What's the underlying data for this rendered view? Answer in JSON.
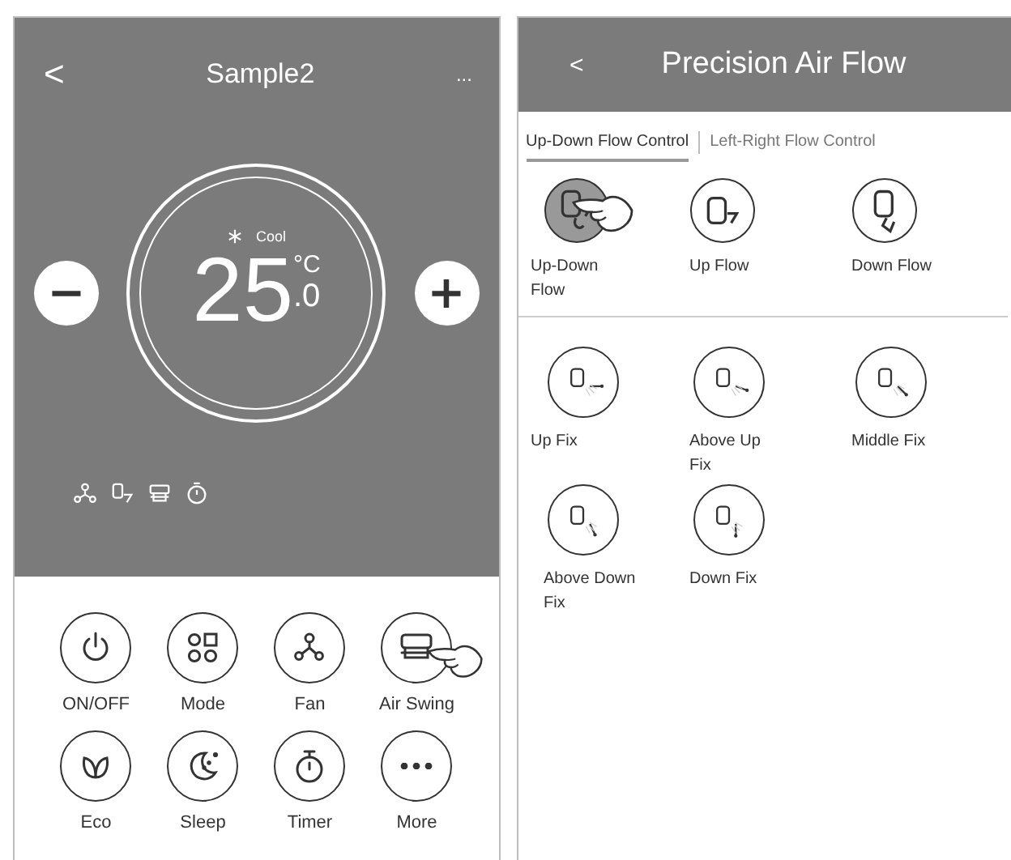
{
  "main_screen": {
    "back": "<",
    "title": "Sample2",
    "menu": "...",
    "mode": "Cool",
    "temperature": "25",
    "unit": "°C",
    "decimal": ".0",
    "minus": "−",
    "plus": "+",
    "buttons": [
      {
        "label": "ON/OFF",
        "kind": "power",
        "pressed": false
      },
      {
        "label": "Mode",
        "kind": "mode",
        "pressed": false
      },
      {
        "label": "Fan",
        "kind": "fan",
        "pressed": false
      },
      {
        "label": "Air Swing",
        "kind": "swing",
        "pressed": true
      },
      {
        "label": "Eco",
        "kind": "eco",
        "pressed": false
      },
      {
        "label": "Sleep",
        "kind": "sleep",
        "pressed": false
      },
      {
        "label": "Timer",
        "kind": "timer",
        "pressed": false
      },
      {
        "label": "More",
        "kind": "more",
        "pressed": false
      }
    ]
  },
  "air_flow_screen": {
    "back": "<",
    "title": "Precision Air Flow",
    "tabs": [
      {
        "label": "Up-Down Flow Control",
        "selected": true
      },
      {
        "label": "Left-Right Flow Control",
        "selected": false
      }
    ],
    "flow_options": [
      {
        "label": "Up-Down Flow",
        "kind": "swing",
        "selected": true
      },
      {
        "label": "Up Flow",
        "kind": "up",
        "selected": false
      },
      {
        "label": "Down Flow",
        "kind": "down",
        "selected": false
      }
    ],
    "fix_options": [
      {
        "label": "Up Fix",
        "kind": "fix0",
        "selected": false
      },
      {
        "label": "Above Up Fix",
        "kind": "fix1",
        "selected": false
      },
      {
        "label": "Middle Fix",
        "kind": "fix2",
        "selected": false
      },
      {
        "label": "Above Down Fix",
        "kind": "fix3",
        "selected": false
      },
      {
        "label": "Down Fix",
        "kind": "fix4",
        "selected": false
      }
    ]
  }
}
